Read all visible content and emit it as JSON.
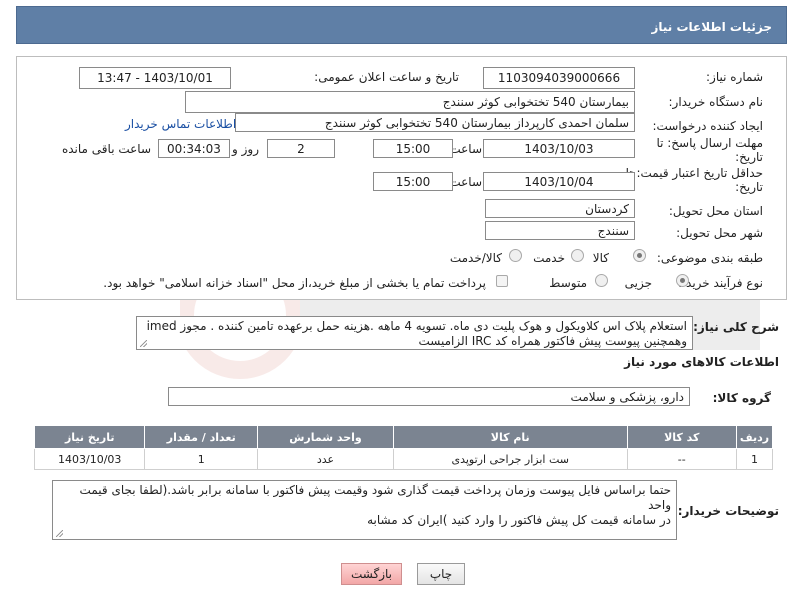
{
  "header": {
    "title": "جزئیات اطلاعات نیاز"
  },
  "form": {
    "need_number": {
      "label": "شماره نیاز:",
      "value": "1103094039000666"
    },
    "announce_datetime": {
      "label": "تاریخ و ساعت اعلان عمومی:",
      "value": "1403/10/01 - 13:47"
    },
    "buyer_org": {
      "label": "نام دستگاه خریدار:",
      "value": "بیمارستان 540 تختخوابی کوثر سنندج"
    },
    "requester": {
      "label": "ایجاد کننده درخواست:",
      "value": "سلمان احمدی کارپرداز بیمارستان 540 تختخوابی کوثر سنندج",
      "contact_link": "اطلاعات تماس خریدار"
    },
    "response_deadline": {
      "label_line1": "مهلت ارسال پاسخ: تا",
      "label_line2": "تاریخ:",
      "date": "1403/10/03",
      "time_label": "ساعت",
      "time": "15:00",
      "days": "2",
      "days_label": "روز و",
      "remaining": "00:34:03",
      "remaining_label": "ساعت باقی مانده"
    },
    "price_validity": {
      "label_line1": "حداقل تاریخ اعتبار قیمت: تا",
      "label_line2": "تاریخ:",
      "date": "1403/10/04",
      "time_label": "ساعت",
      "time": "15:00"
    },
    "province": {
      "label": "استان محل تحویل:",
      "value": "کردستان"
    },
    "city": {
      "label": "شهر محل تحویل:",
      "value": "سنندج"
    },
    "category": {
      "label": "طبقه بندی موضوعی:",
      "options": [
        "کالا",
        "خدمت",
        "کالا/خدمت"
      ],
      "selected": "کالا"
    },
    "purchase_type": {
      "label": "نوع فرآیند خرید :",
      "options": [
        "جزیی",
        "متوسط"
      ],
      "selected": "جزیی",
      "checkbox_label": "پرداخت تمام یا بخشی از مبلغ خرید،از محل \"اسناد خزانه اسلامی\" خواهد بود."
    }
  },
  "description": {
    "label": "شرح کلی نیاز:",
    "text_line1": "استعلام پلاک اس کلاویکول و هوک پلیت دی ماه. تسویه 4 ماهه .هزینه حمل برعهده تامین کننده . مجوز imed",
    "text_line2": "وهمچنین پیوست پیش فاکتور همراه کد IRC  الزامیست"
  },
  "goods_info": {
    "title": "اطلاعات کالاهای مورد نیاز",
    "group_label": "گروه کالا:",
    "group_value": "دارو، پزشکی و سلامت"
  },
  "table": {
    "columns": [
      "ردیف",
      "کد کالا",
      "نام کالا",
      "واحد شمارش",
      "تعداد / مقدار",
      "تاریخ نیاز"
    ],
    "rows": [
      {
        "row": "1",
        "code": "--",
        "name": "ست ابزار جراحی ارتوپدی",
        "unit": "عدد",
        "qty": "1",
        "date": "1403/10/03"
      }
    ]
  },
  "buyer_notes": {
    "label": "توضیحات خریدار:",
    "line1": "حتما براساس فایل پیوست  وزمان پرداخت قیمت گذاری شود وقیمت پیش فاکتور با سامانه برابر باشد.(لطفا بجای قیمت واحد",
    "line2": "در سامانه قیمت کل پیش فاکتور را وارد کنید )ایران کد مشابه"
  },
  "buttons": {
    "print": "چاپ",
    "back": "بازگشت"
  },
  "colors": {
    "header_bg": "#5f7fa6",
    "table_header_bg": "#7b8491",
    "link": "#1a4fa3",
    "back_button": "#f2a7a7"
  }
}
